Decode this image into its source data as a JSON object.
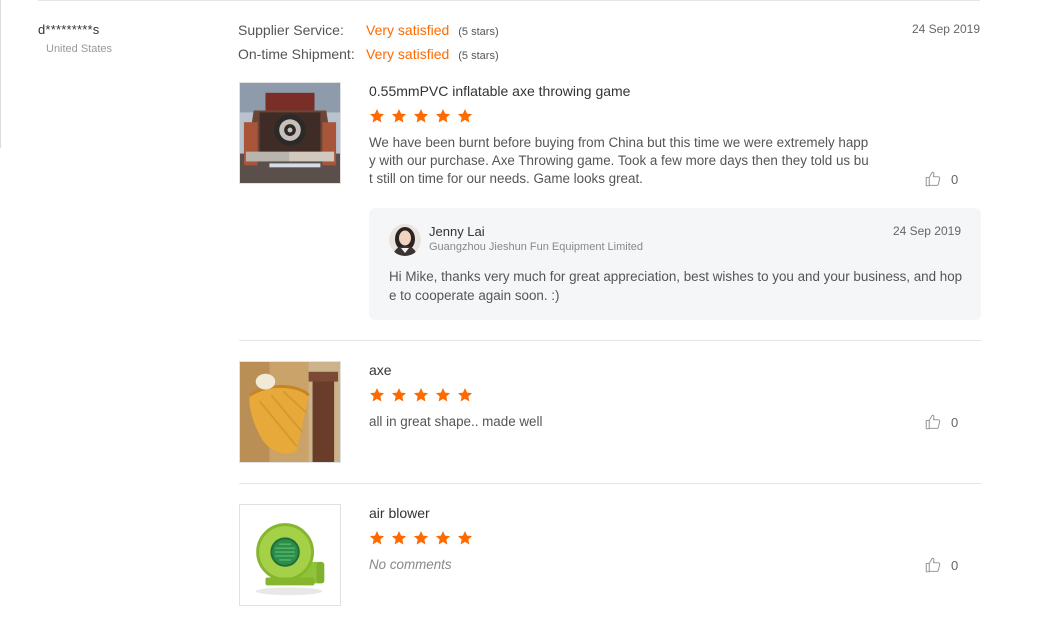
{
  "buyer": {
    "name": "d*********s",
    "country": "United States"
  },
  "ratings": [
    {
      "label": "Supplier Service:",
      "value": "Very satisfied",
      "stars_text": "(5 stars)"
    },
    {
      "label": "On-time Shipment:",
      "value": "Very satisfied",
      "stars_text": "(5 stars)"
    }
  ],
  "review_date": "24 Sep 2019",
  "products": [
    {
      "title": "0.55mmPVC inflatable axe throwing game",
      "rating": 5,
      "text": "We have been burnt before buying from China but this time we were extremely happy with our purchase.  Axe Throwing game.  Took a few more days then they told us but still on time for our needs.  Game looks great.",
      "likes": "0",
      "thumbnail_icon": "inflatable-axe-throwing-game-image"
    },
    {
      "title": "axe",
      "rating": 5,
      "text": "all in great shape.. made well",
      "likes": "0",
      "thumbnail_icon": "inflatable-axe-image"
    },
    {
      "title": "air blower",
      "rating": 5,
      "text": "No comments",
      "likes": "0",
      "thumbnail_icon": "air-blower-image"
    }
  ],
  "reply": {
    "name": "Jenny Lai",
    "company": "Guangzhou Jieshun Fun Equipment Limited",
    "date": "24 Sep 2019",
    "text": "Hi Mike, thanks very much for great appreciation, best wishes to you and your business, and hope to cooperate again soon. :)"
  },
  "colors": {
    "accent": "#ff6a00",
    "star": "#ff6a00",
    "reply_background": "#f5f6f7"
  }
}
